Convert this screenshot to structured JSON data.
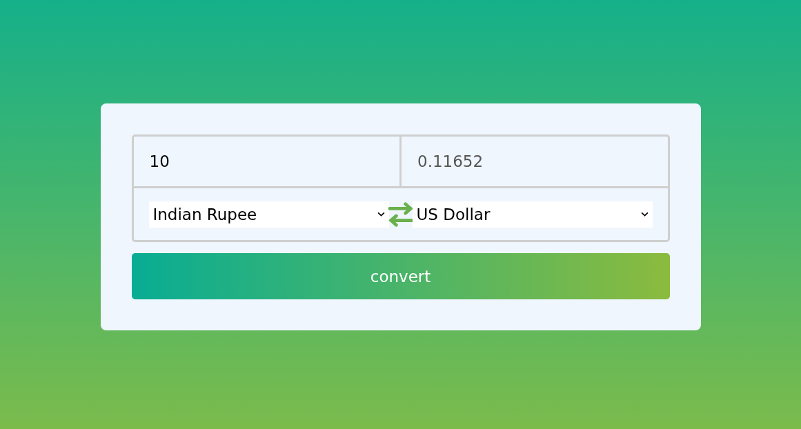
{
  "amount_input": {
    "value": "10"
  },
  "result_output": {
    "value": "0.11652"
  },
  "from_currency": {
    "value": "Indian Rupee"
  },
  "to_currency": {
    "value": "US Dollar"
  },
  "convert_button": {
    "label": "convert"
  }
}
